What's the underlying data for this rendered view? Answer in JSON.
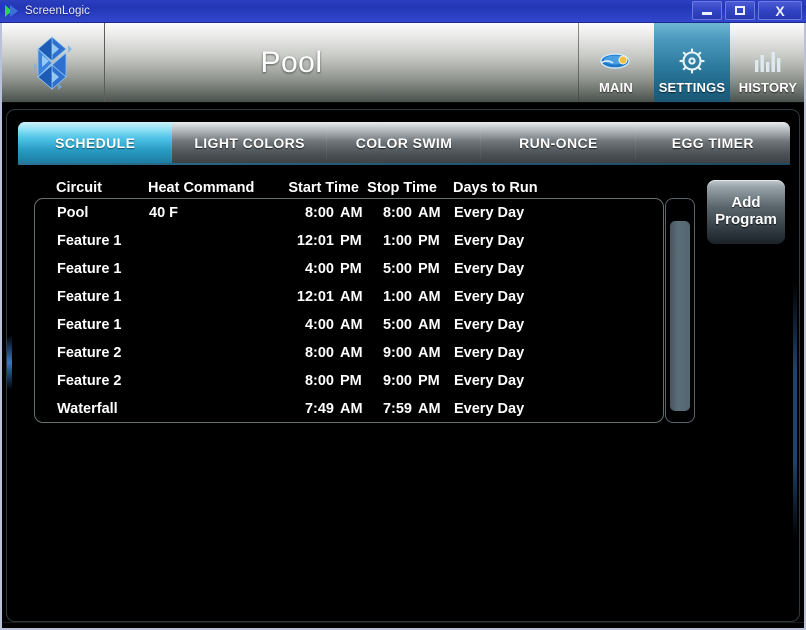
{
  "window": {
    "title": "ScreenLogic",
    "app_icon": "screenlogic-logo-icon",
    "buttons": {
      "minimize": "minimize-icon",
      "maximize": "maximize-icon",
      "close": "X"
    }
  },
  "header": {
    "logo": "pentair-diamond-logo",
    "page_title": "Pool",
    "nav": [
      {
        "label": "MAIN",
        "icon": "pool-water-icon",
        "active": false
      },
      {
        "label": "SETTINGS",
        "icon": "gear-icon",
        "active": true
      },
      {
        "label": "HISTORY",
        "icon": "bar-chart-icon",
        "active": false
      }
    ]
  },
  "tabs": [
    {
      "label": "SCHEDULE",
      "active": true
    },
    {
      "label": "LIGHT COLORS",
      "active": false
    },
    {
      "label": "COLOR SWIM",
      "active": false
    },
    {
      "label": "RUN-ONCE",
      "active": false
    },
    {
      "label": "EGG TIMER",
      "active": false
    }
  ],
  "schedule_table": {
    "columns": [
      "Circuit",
      "Heat Command",
      "Start Time",
      "Stop Time",
      "Days to Run"
    ],
    "rows": [
      {
        "circuit": "Pool",
        "heat_command": "40 F",
        "start_time": "8:00",
        "start_meridiem": "AM",
        "stop_time": "8:00",
        "stop_meridiem": "AM",
        "days_to_run": "Every Day"
      },
      {
        "circuit": "Feature 1",
        "heat_command": "",
        "start_time": "12:01",
        "start_meridiem": "PM",
        "stop_time": "1:00",
        "stop_meridiem": "PM",
        "days_to_run": "Every Day"
      },
      {
        "circuit": "Feature 1",
        "heat_command": "",
        "start_time": "4:00",
        "start_meridiem": "PM",
        "stop_time": "5:00",
        "stop_meridiem": "PM",
        "days_to_run": "Every Day"
      },
      {
        "circuit": "Feature 1",
        "heat_command": "",
        "start_time": "12:01",
        "start_meridiem": "AM",
        "stop_time": "1:00",
        "stop_meridiem": "AM",
        "days_to_run": "Every Day"
      },
      {
        "circuit": "Feature 1",
        "heat_command": "",
        "start_time": "4:00",
        "start_meridiem": "AM",
        "stop_time": "5:00",
        "stop_meridiem": "AM",
        "days_to_run": "Every Day"
      },
      {
        "circuit": "Feature 2",
        "heat_command": "",
        "start_time": "8:00",
        "start_meridiem": "AM",
        "stop_time": "9:00",
        "stop_meridiem": "AM",
        "days_to_run": "Every Day"
      },
      {
        "circuit": "Feature 2",
        "heat_command": "",
        "start_time": "8:00",
        "start_meridiem": "PM",
        "stop_time": "9:00",
        "stop_meridiem": "PM",
        "days_to_run": "Every Day"
      },
      {
        "circuit": "Waterfall",
        "heat_command": "",
        "start_time": "7:49",
        "start_meridiem": "AM",
        "stop_time": "7:59",
        "stop_meridiem": "AM",
        "days_to_run": "Every Day"
      }
    ]
  },
  "actions": {
    "add_program_line1": "Add",
    "add_program_line2": "Program"
  },
  "colors": {
    "titlebar_blue": "#2a3fc0",
    "active_tab_cyan": "#4ec2e6",
    "active_nav_blue": "#2c7b9e",
    "panel_background": "#000000",
    "text_white": "#ffffff",
    "scroll_thumb": "#5b6d78"
  }
}
